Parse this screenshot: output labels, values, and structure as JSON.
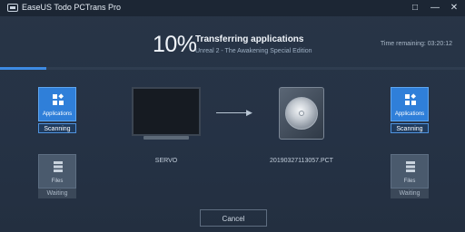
{
  "window": {
    "title": "EaseUS Todo PCTrans Pro"
  },
  "progress": {
    "percent_label": "10%",
    "fraction": 0.1,
    "title": "Transferring applications",
    "subtitle": "Unreal 2 - The Awakening Special Edition",
    "time_remaining": "Time remaining: 03:20:12"
  },
  "left": {
    "applications": {
      "label": "Applications",
      "status": "Scanning"
    },
    "files": {
      "label": "Files",
      "status": "Waiting"
    }
  },
  "source": {
    "name": "SERVO"
  },
  "target": {
    "name": "20190327113057.PCT"
  },
  "right": {
    "applications": {
      "label": "Applications",
      "status": "Scanning"
    },
    "files": {
      "label": "Files",
      "status": "Waiting"
    }
  },
  "buttons": {
    "cancel": "Cancel"
  },
  "colors": {
    "accent": "#2f7fd9",
    "progress": "#3d8be3",
    "background": "#253245"
  }
}
